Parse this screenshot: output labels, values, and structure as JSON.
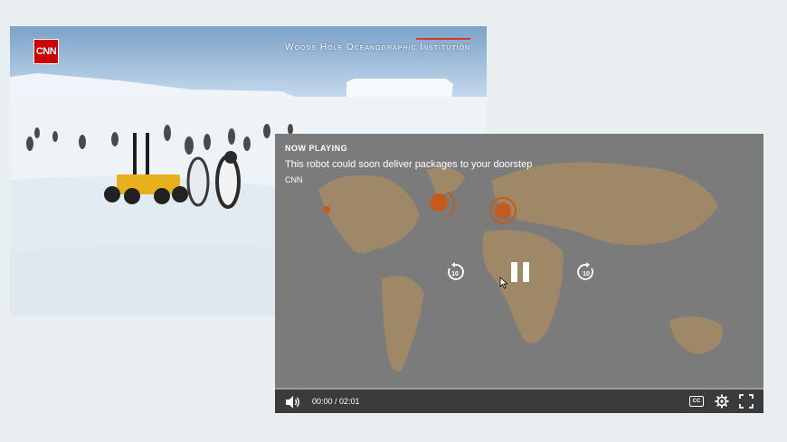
{
  "background_video": {
    "logo": "CNN",
    "credit": "Woods Hole Oceanographic Institution"
  },
  "player": {
    "now_playing": "NOW PLAYING",
    "title": "This robot could soon deliver packages to your doorstep",
    "source": "CNN",
    "time": "00:00 / 02:01",
    "progress": 0,
    "cc_label": "CC",
    "colors": {
      "accent": "#c65a1e",
      "map_land": "#a38a66",
      "player_bg": "#7b7b7b"
    }
  },
  "icons": [
    "volume-icon",
    "rewind-10-icon",
    "pause-icon",
    "forward-10-icon",
    "closed-captions-icon",
    "gear-icon",
    "fullscreen-icon"
  ]
}
